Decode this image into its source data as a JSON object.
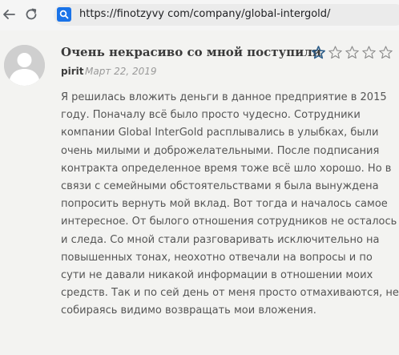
{
  "browser": {
    "url": "https://finotzyvy com/company/global-intergold/",
    "back_icon": "arrow-left-icon",
    "reload_icon": "reload-icon",
    "site_icon": "search-favicon"
  },
  "review": {
    "title": "Очень некрасиво со мной поступили",
    "author": "pirit",
    "date": "Март 22, 2019",
    "rating": 1,
    "rating_max": 5,
    "star_color": "#2f5f8a",
    "body_lines": [
      "Я решилась вложить деньги в данное предприятие в 2015",
      "году. Поначалу всё было просто чудесно. Сотрудники",
      "компании Global InterGold расплывались в улыбках, были",
      "очень милыми и доброжелательными. После подписания",
      "контракта определенное время тоже всё шло хорошо. Но в",
      "связи с семейными обстоятельствами я была вынуждена",
      "попросить вернуть мой вклад. Вот тогда и началось самое",
      "интересное. От былого отношения сотрудников не осталось",
      "и следа. Со мной стали разговаривать исключительно на",
      "повышенных тонах, неохотно отвечали на вопросы и по",
      "сути не давали никакой информации в отношении моих",
      "средств. Так и по сей день от меня просто отмахиваются, не",
      "собираясь видимо возвращать мои вложения."
    ]
  }
}
